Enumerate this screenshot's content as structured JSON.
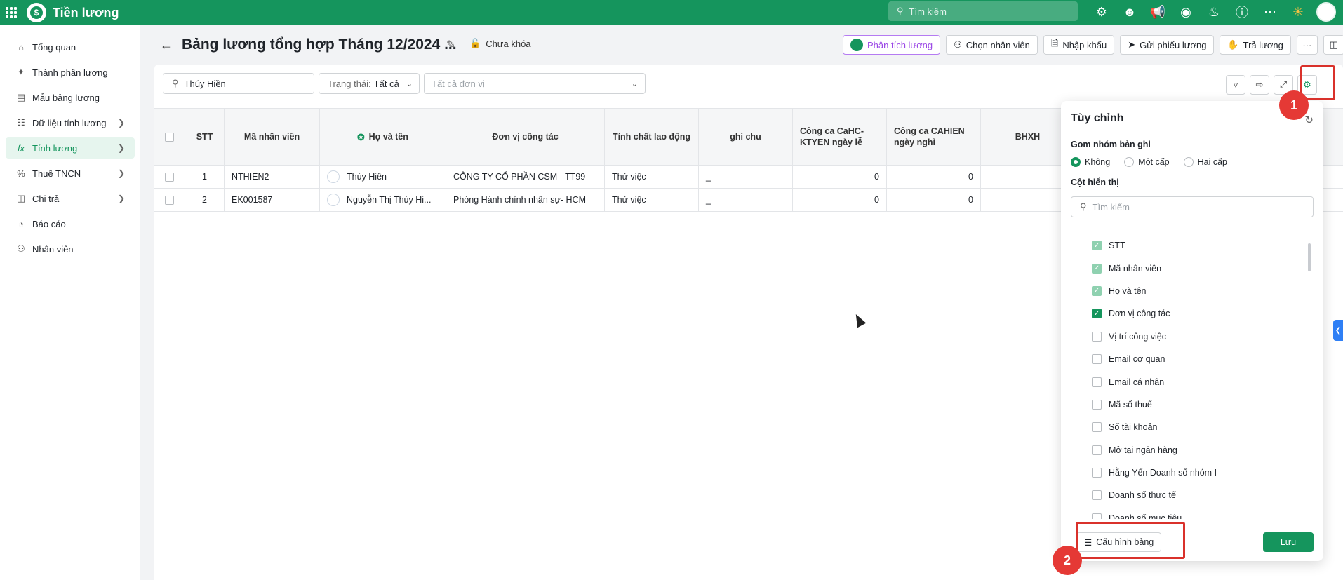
{
  "app": {
    "title": "Tiền lương",
    "logo_letter": "$"
  },
  "topbar": {
    "search_placeholder": "Tìm kiếm",
    "icons": [
      "settings-icon",
      "user-face-icon",
      "megaphone-icon",
      "chat-icon",
      "bell-icon",
      "help-icon",
      "more-icon",
      "lamp-icon"
    ]
  },
  "sidebar": {
    "items": [
      {
        "label": "Tổng quan",
        "icon": "home-icon"
      },
      {
        "label": "Thành phần lương",
        "icon": "components-icon"
      },
      {
        "label": "Mẫu bảng lương",
        "icon": "template-icon"
      },
      {
        "label": "Dữ liệu tính lương",
        "icon": "database-icon"
      },
      {
        "label": "Tính lương",
        "icon": "fx-icon"
      },
      {
        "label": "Thuế TNCN",
        "icon": "percent-icon"
      },
      {
        "label": "Chi trả",
        "icon": "wallet-icon"
      },
      {
        "label": "Báo cáo",
        "icon": "chart-pie-icon"
      },
      {
        "label": "Nhân viên",
        "icon": "people-icon"
      }
    ]
  },
  "header": {
    "title": "Bảng lương tổng hợp Tháng 12/2024 ...",
    "lock_status": "Chưa khóa",
    "actions": {
      "analyze": "Phân tích lương",
      "choose_employee": "Chọn nhân viên",
      "import": "Nhập khẩu",
      "send_slip": "Gửi phiếu lương",
      "pay": "Trả lương",
      "more": "···"
    }
  },
  "filters": {
    "search_value": "Thúy Hiền",
    "status_label": "Trạng thái:",
    "status_value": "Tất cả",
    "unit_placeholder": "Tất cả đơn vị"
  },
  "table": {
    "headers": {
      "stt": "STT",
      "ma": "Mã nhân viên",
      "ten": "Họ và tên",
      "dv": "Đơn vị công tác",
      "tc": "Tính chất lao động",
      "gc": "ghi chu",
      "n1": "Công ca CaHC-KTYEN ngày lễ",
      "n2": "Công ca CAHIEN ngày nghỉ",
      "bh": "BHXH"
    },
    "rows": [
      {
        "stt": "1",
        "ma": "NTHIEN2",
        "ten": "Thúy Hiền",
        "dv": "CÔNG TY CỔ PHẦN CSM - TT99",
        "tc": "Thử việc",
        "gc": "_",
        "n1": "0",
        "n2": "0"
      },
      {
        "stt": "2",
        "ma": "EK001587",
        "ten": "Nguyễn Thị Thúy Hi...",
        "dv": "Phòng Hành chính nhân sự- HCM",
        "tc": "Thử việc",
        "gc": "_",
        "n1": "0",
        "n2": "0"
      }
    ]
  },
  "panel": {
    "title": "Tùy chỉnh",
    "group_label": "Gom nhóm bản ghi",
    "group_options": [
      "Không",
      "Một cấp",
      "Hai cấp"
    ],
    "group_selected": "Không",
    "columns_label": "Cột hiển thị",
    "search_placeholder": "Tìm kiếm",
    "columns": [
      {
        "label": "STT",
        "state": "locked"
      },
      {
        "label": "Mã nhân viên",
        "state": "locked"
      },
      {
        "label": "Họ và tên",
        "state": "locked"
      },
      {
        "label": "Đơn vị công tác",
        "state": "checked"
      },
      {
        "label": "Vị trí công việc",
        "state": "unchecked"
      },
      {
        "label": "Email cơ quan",
        "state": "unchecked"
      },
      {
        "label": "Email cá nhân",
        "state": "unchecked"
      },
      {
        "label": "Mã số thuế",
        "state": "unchecked"
      },
      {
        "label": "Số tài khoản",
        "state": "unchecked"
      },
      {
        "label": "Mở tại ngân hàng",
        "state": "unchecked"
      },
      {
        "label": "Hằng Yến Doanh số nhóm I",
        "state": "unchecked"
      },
      {
        "label": "Doanh số thực tế",
        "state": "unchecked"
      },
      {
        "label": "Doanh số mục tiêu",
        "state": "unchecked"
      }
    ],
    "config_button": "Cấu hình bảng",
    "save_button": "Lưu"
  },
  "annotations": {
    "badge1": "1",
    "badge2": "2"
  },
  "colors": {
    "brand": "#15955d",
    "highlight": "#d9312b",
    "badge": "#e53935",
    "ai_accent": "#9b48e6"
  }
}
